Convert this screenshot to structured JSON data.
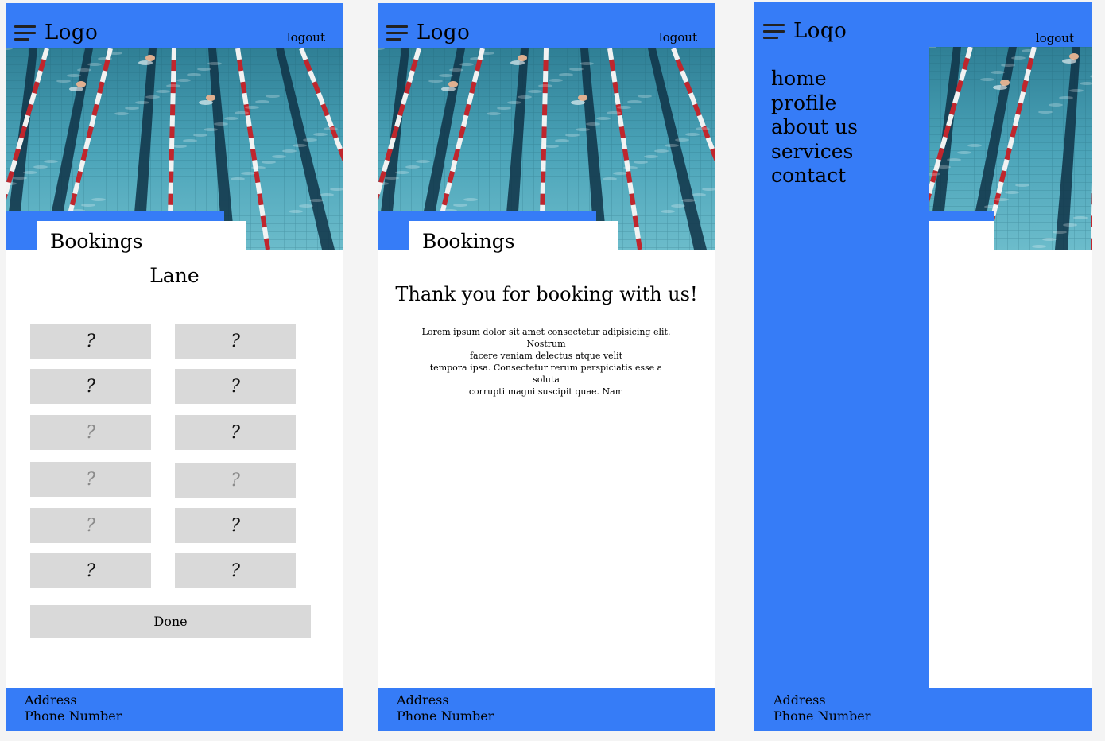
{
  "colors": {
    "accent": "#367cf7",
    "tile": "#d9d9d9",
    "page": "#f4f4f4"
  },
  "header": {
    "logo": "Logo",
    "logout": "logout",
    "menu_icon": "hamburger-menu-icon"
  },
  "header_alt": {
    "logo": "Loqo",
    "logout": "logout"
  },
  "bookings": {
    "title": "Bookings"
  },
  "lane_screen": {
    "lane_label": "Lane",
    "seats": [
      "?",
      "?",
      "?",
      "?",
      "?",
      "?",
      "?",
      "?",
      "?",
      "?",
      "?",
      "?"
    ],
    "done": "Done"
  },
  "confirm_screen": {
    "thanks": "Thank you for booking with us!",
    "body": [
      "Lorem ipsum dolor sit amet consectetur adipisicing elit. Nostrum",
      "facere veniam delectus atque velit",
      "tempora ipsa. Consectetur rerum perspiciatis esse a soluta",
      "corrupti magni suscipit quae. Nam"
    ]
  },
  "menu_screen": {
    "items": [
      "home",
      "profile",
      "about us",
      "services",
      "contact"
    ]
  },
  "footer": {
    "address": "Address",
    "phone": "Phone Number"
  }
}
